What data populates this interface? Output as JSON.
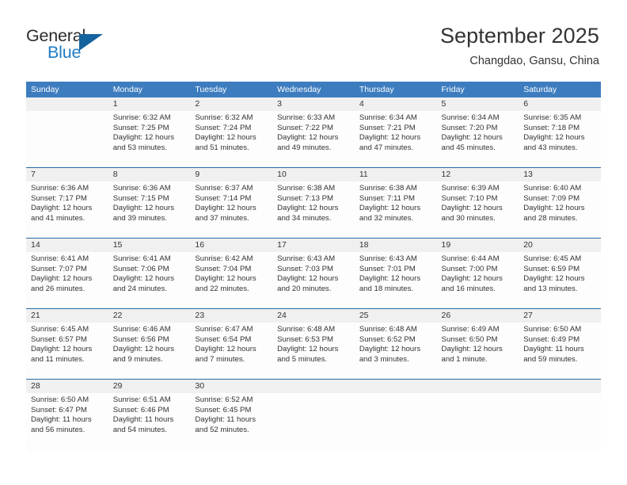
{
  "logo": {
    "word_top": "General",
    "word_bottom": "Blue",
    "icon": "triangle-mark",
    "color_dark": "#2b2b2b",
    "color_blue": "#1e7bc4"
  },
  "header": {
    "title": "September 2025",
    "subtitle": "Changdao, Gansu, China"
  },
  "colors": {
    "header_blue": "#3d7dbf",
    "row_divider_blue": "#2b6ca8",
    "day_number_band": "#f0f0f0",
    "text": "#333333"
  },
  "weekday_headers": [
    "Sunday",
    "Monday",
    "Tuesday",
    "Wednesday",
    "Thursday",
    "Friday",
    "Saturday"
  ],
  "weeks": [
    {
      "numbers": [
        "",
        "1",
        "2",
        "3",
        "4",
        "5",
        "6"
      ],
      "cells": [
        {
          "lines": []
        },
        {
          "lines": [
            "Sunrise: 6:32 AM",
            "Sunset: 7:25 PM",
            "Daylight: 12 hours",
            "and 53 minutes."
          ]
        },
        {
          "lines": [
            "Sunrise: 6:32 AM",
            "Sunset: 7:24 PM",
            "Daylight: 12 hours",
            "and 51 minutes."
          ]
        },
        {
          "lines": [
            "Sunrise: 6:33 AM",
            "Sunset: 7:22 PM",
            "Daylight: 12 hours",
            "and 49 minutes."
          ]
        },
        {
          "lines": [
            "Sunrise: 6:34 AM",
            "Sunset: 7:21 PM",
            "Daylight: 12 hours",
            "and 47 minutes."
          ]
        },
        {
          "lines": [
            "Sunrise: 6:34 AM",
            "Sunset: 7:20 PM",
            "Daylight: 12 hours",
            "and 45 minutes."
          ]
        },
        {
          "lines": [
            "Sunrise: 6:35 AM",
            "Sunset: 7:18 PM",
            "Daylight: 12 hours",
            "and 43 minutes."
          ]
        }
      ]
    },
    {
      "numbers": [
        "7",
        "8",
        "9",
        "10",
        "11",
        "12",
        "13"
      ],
      "cells": [
        {
          "lines": [
            "Sunrise: 6:36 AM",
            "Sunset: 7:17 PM",
            "Daylight: 12 hours",
            "and 41 minutes."
          ]
        },
        {
          "lines": [
            "Sunrise: 6:36 AM",
            "Sunset: 7:15 PM",
            "Daylight: 12 hours",
            "and 39 minutes."
          ]
        },
        {
          "lines": [
            "Sunrise: 6:37 AM",
            "Sunset: 7:14 PM",
            "Daylight: 12 hours",
            "and 37 minutes."
          ]
        },
        {
          "lines": [
            "Sunrise: 6:38 AM",
            "Sunset: 7:13 PM",
            "Daylight: 12 hours",
            "and 34 minutes."
          ]
        },
        {
          "lines": [
            "Sunrise: 6:38 AM",
            "Sunset: 7:11 PM",
            "Daylight: 12 hours",
            "and 32 minutes."
          ]
        },
        {
          "lines": [
            "Sunrise: 6:39 AM",
            "Sunset: 7:10 PM",
            "Daylight: 12 hours",
            "and 30 minutes."
          ]
        },
        {
          "lines": [
            "Sunrise: 6:40 AM",
            "Sunset: 7:09 PM",
            "Daylight: 12 hours",
            "and 28 minutes."
          ]
        }
      ]
    },
    {
      "numbers": [
        "14",
        "15",
        "16",
        "17",
        "18",
        "19",
        "20"
      ],
      "cells": [
        {
          "lines": [
            "Sunrise: 6:41 AM",
            "Sunset: 7:07 PM",
            "Daylight: 12 hours",
            "and 26 minutes."
          ]
        },
        {
          "lines": [
            "Sunrise: 6:41 AM",
            "Sunset: 7:06 PM",
            "Daylight: 12 hours",
            "and 24 minutes."
          ]
        },
        {
          "lines": [
            "Sunrise: 6:42 AM",
            "Sunset: 7:04 PM",
            "Daylight: 12 hours",
            "and 22 minutes."
          ]
        },
        {
          "lines": [
            "Sunrise: 6:43 AM",
            "Sunset: 7:03 PM",
            "Daylight: 12 hours",
            "and 20 minutes."
          ]
        },
        {
          "lines": [
            "Sunrise: 6:43 AM",
            "Sunset: 7:01 PM",
            "Daylight: 12 hours",
            "and 18 minutes."
          ]
        },
        {
          "lines": [
            "Sunrise: 6:44 AM",
            "Sunset: 7:00 PM",
            "Daylight: 12 hours",
            "and 16 minutes."
          ]
        },
        {
          "lines": [
            "Sunrise: 6:45 AM",
            "Sunset: 6:59 PM",
            "Daylight: 12 hours",
            "and 13 minutes."
          ]
        }
      ]
    },
    {
      "numbers": [
        "21",
        "22",
        "23",
        "24",
        "25",
        "26",
        "27"
      ],
      "cells": [
        {
          "lines": [
            "Sunrise: 6:45 AM",
            "Sunset: 6:57 PM",
            "Daylight: 12 hours",
            "and 11 minutes."
          ]
        },
        {
          "lines": [
            "Sunrise: 6:46 AM",
            "Sunset: 6:56 PM",
            "Daylight: 12 hours",
            "and 9 minutes."
          ]
        },
        {
          "lines": [
            "Sunrise: 6:47 AM",
            "Sunset: 6:54 PM",
            "Daylight: 12 hours",
            "and 7 minutes."
          ]
        },
        {
          "lines": [
            "Sunrise: 6:48 AM",
            "Sunset: 6:53 PM",
            "Daylight: 12 hours",
            "and 5 minutes."
          ]
        },
        {
          "lines": [
            "Sunrise: 6:48 AM",
            "Sunset: 6:52 PM",
            "Daylight: 12 hours",
            "and 3 minutes."
          ]
        },
        {
          "lines": [
            "Sunrise: 6:49 AM",
            "Sunset: 6:50 PM",
            "Daylight: 12 hours",
            "and 1 minute."
          ]
        },
        {
          "lines": [
            "Sunrise: 6:50 AM",
            "Sunset: 6:49 PM",
            "Daylight: 11 hours",
            "and 59 minutes."
          ]
        }
      ]
    },
    {
      "numbers": [
        "28",
        "29",
        "30",
        "",
        "",
        "",
        ""
      ],
      "cells": [
        {
          "lines": [
            "Sunrise: 6:50 AM",
            "Sunset: 6:47 PM",
            "Daylight: 11 hours",
            "and 56 minutes."
          ]
        },
        {
          "lines": [
            "Sunrise: 6:51 AM",
            "Sunset: 6:46 PM",
            "Daylight: 11 hours",
            "and 54 minutes."
          ]
        },
        {
          "lines": [
            "Sunrise: 6:52 AM",
            "Sunset: 6:45 PM",
            "Daylight: 11 hours",
            "and 52 minutes."
          ]
        },
        {
          "lines": []
        },
        {
          "lines": []
        },
        {
          "lines": []
        },
        {
          "lines": []
        }
      ]
    }
  ]
}
